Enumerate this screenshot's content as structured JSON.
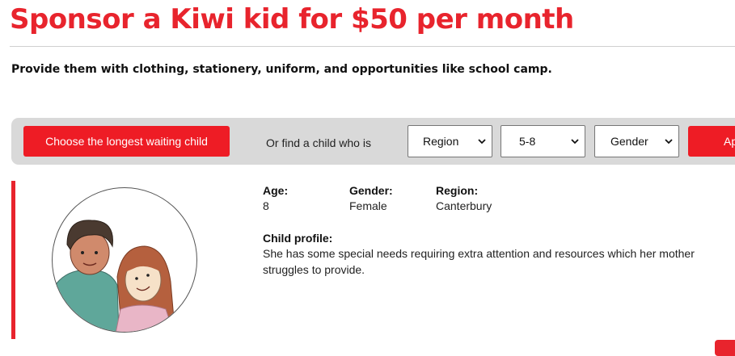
{
  "page": {
    "title": "Sponsor a Kiwi kid for $50 per month",
    "subtitle": "Provide them with clothing, stationery, uniform, and opportunities like school camp."
  },
  "filter_bar": {
    "longest_button": "Choose the longest waiting child",
    "or_text": "Or find a child who is",
    "region_select": "Region",
    "age_select": "5-8",
    "gender_select": "Gender",
    "apply_button": "Ap"
  },
  "child": {
    "age_label": "Age:",
    "age_value": "8",
    "gender_label": "Gender:",
    "gender_value": "Female",
    "region_label": "Region:",
    "region_value": "Canterbury",
    "profile_label": "Child profile:",
    "profile_text": "She has some special needs requiring extra attention and resources which her mother struggles to provide.",
    "avatar_icon": "child-drawing-icon"
  },
  "colors": {
    "brand_red": "#e8242d",
    "button_red": "#ee1c25",
    "bar_gray": "#d9d9d9"
  }
}
